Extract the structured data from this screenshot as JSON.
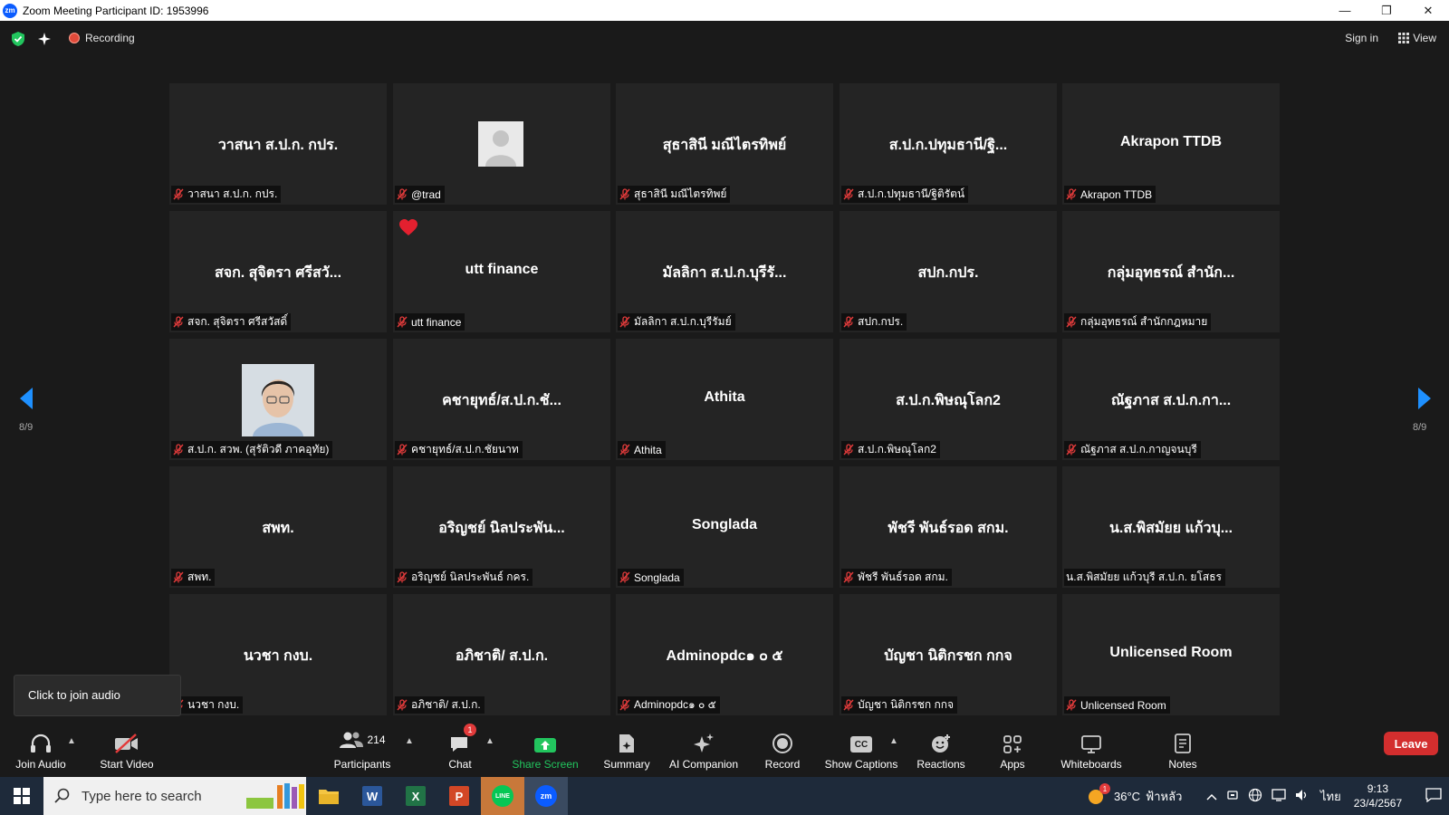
{
  "window": {
    "title": "Zoom Meeting Participant ID: 1953996",
    "logo_text": "zm",
    "minimize": "—",
    "restore": "❐",
    "close": "✕"
  },
  "topbar": {
    "recording_label": "Recording",
    "signin_label": "Sign in",
    "view_label": "View"
  },
  "pager": {
    "left_label": "8/9",
    "right_label": "8/9"
  },
  "tiles": [
    {
      "big": "วาสนา ส.ป.ก. กปร.",
      "label": "วาสนา ส.ป.ก. กปร.",
      "muted": true,
      "kind": "text"
    },
    {
      "big": "",
      "label": "@trad",
      "muted": true,
      "kind": "avatar"
    },
    {
      "big": "สุธาสินี มณีไตรทิพย์",
      "label": "สุธาสินี มณีไตรทิพย์",
      "muted": true,
      "kind": "text"
    },
    {
      "big": "ส.ป.ก.ปทุมธานี/ฐิ...",
      "label": "ส.ป.ก.ปทุมธานี/ฐิติรัตน์",
      "muted": true,
      "kind": "text"
    },
    {
      "big": "Akrapon TTDB",
      "label": "Akrapon TTDB",
      "muted": true,
      "kind": "text"
    },
    {
      "big": "สจก. สุจิตรา ศรีสวั...",
      "label": "สจก. สุจิตรา ศรีสวัสดิ์",
      "muted": true,
      "kind": "text"
    },
    {
      "big": "utt finance",
      "label": "utt finance",
      "muted": true,
      "kind": "heart"
    },
    {
      "big": "มัลลิกา ส.ป.ก.บุรีรั...",
      "label": "มัลลิกา ส.ป.ก.บุรีรัมย์",
      "muted": true,
      "kind": "text"
    },
    {
      "big": "สปก.กปร.",
      "label": "สปก.กปร.",
      "muted": true,
      "kind": "text"
    },
    {
      "big": "กลุ่มอุทธรณ์ สำนัก...",
      "label": "กลุ่มอุทธรณ์ สำนักกฎหมาย",
      "muted": true,
      "kind": "text"
    },
    {
      "big": "",
      "label": "ส.ป.ก. สวพ. (สุรัติวดี ภาคอุทัย)",
      "muted": true,
      "kind": "photo"
    },
    {
      "big": "คชายุทธ์/ส.ป.ก.ชั...",
      "label": "คชายุทธ์/ส.ป.ก.ชัยนาท",
      "muted": true,
      "kind": "text"
    },
    {
      "big": "Athita",
      "label": "Athita",
      "muted": true,
      "kind": "text"
    },
    {
      "big": "ส.ป.ก.พิษณุโลก2",
      "label": "ส.ป.ก.พิษณุโลก2",
      "muted": true,
      "kind": "text"
    },
    {
      "big": "ณัฐภาส ส.ป.ก.กา...",
      "label": "ณัฐภาส ส.ป.ก.กาญจนบุรี",
      "muted": true,
      "kind": "text"
    },
    {
      "big": "สพท.",
      "label": "สพท.",
      "muted": true,
      "kind": "text"
    },
    {
      "big": "อริญชย์ นิลประพัน...",
      "label": "อริญชย์ นิลประพันธ์ กคร.",
      "muted": true,
      "kind": "text"
    },
    {
      "big": "Songlada",
      "label": "Songlada",
      "muted": true,
      "kind": "text"
    },
    {
      "big": "พัชรี พันธ์รอด สกม.",
      "label": "พัชรี พันธ์รอด สกม.",
      "muted": true,
      "kind": "text"
    },
    {
      "big": "น.ส.พิสมัยย แก้วบุ...",
      "label": "น.ส.พิสมัยย แก้วบุรี ส.ป.ก. ยโสธร",
      "muted": false,
      "kind": "text"
    },
    {
      "big": "นวชา กงบ.",
      "label": "นวชา กงบ.",
      "muted": true,
      "kind": "text"
    },
    {
      "big": "อภิชาติ/ ส.ป.ก.",
      "label": "อภิชาติ/ ส.ป.ก.",
      "muted": true,
      "kind": "text"
    },
    {
      "big": "Adminopdc๑ ๐ ๕",
      "label": "Adminopdc๑ ๐ ๕",
      "muted": true,
      "kind": "text"
    },
    {
      "big": "บัญชา นิติกรชก กกจ",
      "label": "บัญชา นิติกรชก กกจ",
      "muted": true,
      "kind": "text"
    },
    {
      "big": "Unlicensed Room",
      "label": "Unlicensed Room",
      "muted": true,
      "kind": "text"
    }
  ],
  "tooltip": "Click to join audio",
  "toolbar": {
    "join_audio": "Join Audio",
    "start_video": "Start Video",
    "participants": "Participants",
    "participants_count": "214",
    "chat": "Chat",
    "chat_badge": "1",
    "share_screen": "Share Screen",
    "summary": "Summary",
    "ai_companion": "AI Companion",
    "record": "Record",
    "show_captions": "Show Captions",
    "captions_icon_text": "CC",
    "reactions": "Reactions",
    "apps": "Apps",
    "whiteboards": "Whiteboards",
    "notes": "Notes",
    "leave": "Leave"
  },
  "taskbar": {
    "search_placeholder": "Type here to search",
    "weather_temp": "36°C",
    "weather_desc": "ฟ้าหลัว",
    "weather_badge": "1",
    "lang": "ไทย",
    "time": "9:13",
    "date": "23/4/2567",
    "word_letter": "W",
    "excel_letter": "X",
    "ppt_letter": "P",
    "line_text": "LINE",
    "zoom_text": "zm"
  },
  "colors": {
    "accent": "#0b5cff",
    "share_green": "#22c55e",
    "leave_red": "#d32e2e",
    "muted_red": "#e23b3b"
  }
}
